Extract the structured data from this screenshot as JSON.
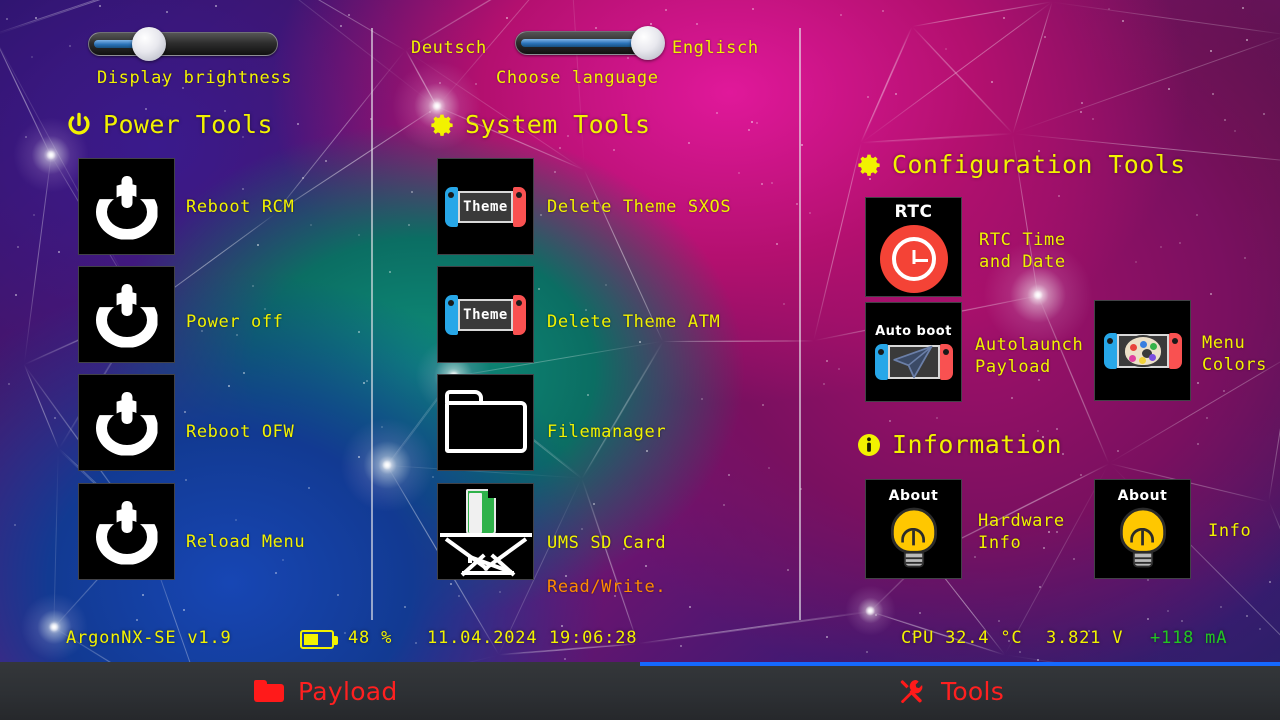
{
  "app": {
    "version_label": "ArgonNX-SE v1.9"
  },
  "controls": {
    "brightness": {
      "label": "Display brightness",
      "value_pct": 30,
      "icon": "slider-handle"
    },
    "language": {
      "label": "Choose language",
      "left_option": "Deutsch",
      "right_option": "Englisch",
      "selected": "Englisch",
      "value_pct": 92
    }
  },
  "sections": {
    "power": {
      "title": "Power Tools",
      "icon": "power-icon",
      "items": [
        {
          "label": "Reboot RCM",
          "icon": "power-glyph"
        },
        {
          "label": "Power off",
          "icon": "power-glyph"
        },
        {
          "label": "Reboot OFW",
          "icon": "power-glyph"
        },
        {
          "label": "Reload Menu",
          "icon": "power-glyph"
        }
      ]
    },
    "system": {
      "title": "System Tools",
      "icon": "gear-icon",
      "items": [
        {
          "label": "Delete Theme SXOS",
          "icon": "switch-theme-icon",
          "caption": "Theme"
        },
        {
          "label": "Delete Theme ATM",
          "icon": "switch-theme-icon",
          "caption": "Theme"
        },
        {
          "label": "Filemanager",
          "icon": "folder-icon",
          "caption": ""
        },
        {
          "label": "UMS SD Card",
          "label2": "Read/Write.",
          "icon": "sd-card-icon",
          "caption": ""
        }
      ]
    },
    "configuration": {
      "title": "Configuration Tools",
      "icon": "gear-icon",
      "items": [
        {
          "label": "RTC Time\nand Date",
          "icon": "rtc-clock-icon",
          "caption": "RTC"
        },
        {
          "label": "Autolaunch\nPayload",
          "icon": "autoboot-icon",
          "caption": "Auto boot"
        },
        {
          "label": "Menu\nColors",
          "icon": "palette-switch-icon",
          "caption": ""
        }
      ]
    },
    "information": {
      "title": "Information",
      "icon": "info-icon",
      "items": [
        {
          "label": "Hardware\nInfo",
          "icon": "lightbulb-icon",
          "caption": "About"
        },
        {
          "label": "Info",
          "icon": "lightbulb-icon",
          "caption": "About"
        }
      ]
    }
  },
  "status": {
    "battery_icon": "battery-icon",
    "battery_pct": "48 %",
    "battery_level": 48,
    "date": "11.04.2024",
    "time": "19:06:28",
    "cpu_temp": "CPU 32.4 °C",
    "voltage": "3.821 V",
    "current": "+118 mA",
    "current_color": "#22c522"
  },
  "tabs": [
    {
      "label": "Payload",
      "icon": "folder-icon",
      "active": false
    },
    {
      "label": "Tools",
      "icon": "tools-icon",
      "active": true
    }
  ],
  "colors": {
    "accent_yellow": "#f2f200",
    "tab_red": "#ff2020",
    "tab_active_indicator": "#1569ff",
    "warn_orange": "#ff8c00"
  }
}
